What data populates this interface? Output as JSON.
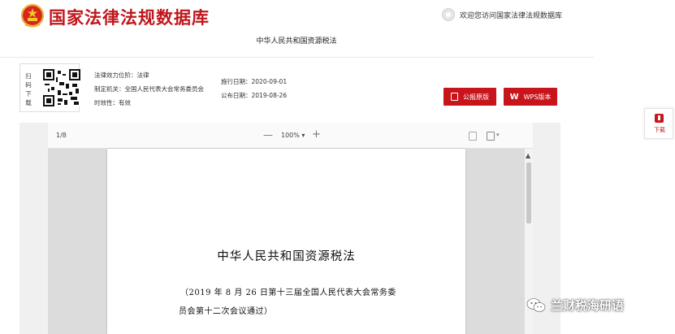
{
  "header": {
    "site_title": "国家法律法规数据库",
    "welcome_text": "欢迎您访问国家法律法规数据库",
    "law_title": "中华人民共和国资源税法"
  },
  "info": {
    "scan_label": "扫码下载",
    "effect_level": "法律效力位阶：法律",
    "enacting_body": "制定机关：全国人民代表大会常务委员会",
    "validity": "时效性：有效",
    "effective_date": "施行日期：2020-09-01",
    "publish_date": "公布日期：2019-08-26"
  },
  "buttons": {
    "official_pdf": "公报原版",
    "wps": "WPS版本"
  },
  "viewer": {
    "page_count": "1/8",
    "zoom": "100%",
    "zoom_out": "—",
    "zoom_in": "+"
  },
  "document": {
    "title": "中华人民共和国资源税法",
    "note_line1": "（2019 年 8 月 26 日第十三届全国人民代表大会常务委",
    "note_line2": "员会第十二次会议通过）"
  },
  "floating": {
    "download_label": "下载"
  },
  "watermark": {
    "text": "兰财税海研语"
  },
  "colors": {
    "brand_red": "#c8151c",
    "title_red": "#c0161c",
    "viewer_bg": "#dcdcdc"
  }
}
